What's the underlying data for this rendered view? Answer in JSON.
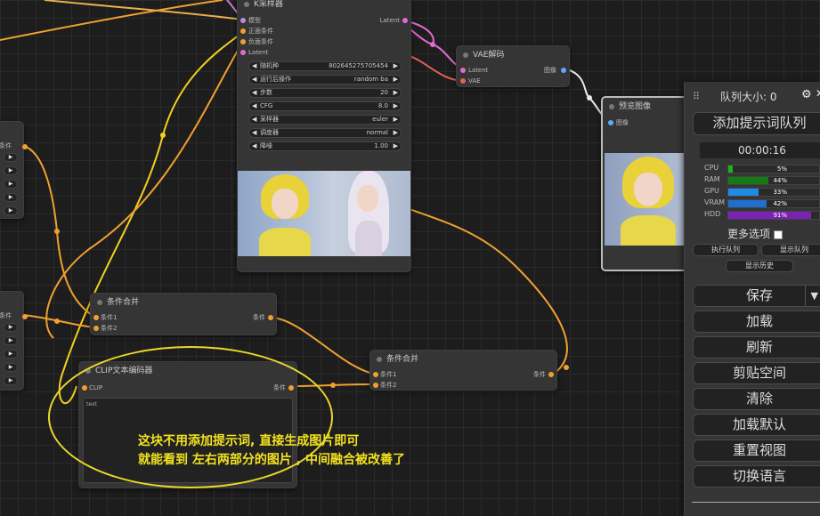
{
  "ksampler": {
    "title": "K采样器",
    "inputs": [
      "模型",
      "正面条件",
      "负面条件",
      "Latent"
    ],
    "output": "Latent",
    "widgets": [
      {
        "label": "随机种",
        "value": "802645275705454"
      },
      {
        "label": "运行后操作",
        "value": "random ba"
      },
      {
        "label": "步数",
        "value": "20"
      },
      {
        "label": "CFG",
        "value": "8.0"
      },
      {
        "label": "采样器",
        "value": "euler"
      },
      {
        "label": "调度器",
        "value": "normal"
      },
      {
        "label": "降噪",
        "value": "1.00"
      }
    ]
  },
  "vae_decode": {
    "title": "VAE解码",
    "inputs": [
      "Latent",
      "VAE"
    ],
    "output": "图像"
  },
  "preview": {
    "title": "预览图像",
    "input": "图像"
  },
  "cond_combine_1": {
    "title": "条件合并",
    "inputs": [
      "条件1",
      "条件2"
    ],
    "output": "条件"
  },
  "cond_combine_2": {
    "title": "条件合并",
    "inputs": [
      "条件1",
      "条件2"
    ],
    "output": "条件"
  },
  "clip_encode": {
    "title": "CLIP文本编码器",
    "input": "CLIP",
    "output": "条件",
    "text_value": "text"
  },
  "left_nodes": {
    "slot_label": "条件"
  },
  "annotation": {
    "line1": "这块不用添加提示词, 直接生成图片即可",
    "line2": "就能看到 左右两部分的图片 , 中间融合被改善了"
  },
  "panel": {
    "queue_size_label": "队列大小: 0",
    "queue_prompt": "添加提示词队列",
    "timer": "00:00:16",
    "meters": [
      {
        "name": "CPU",
        "percent": 5,
        "label": "5%",
        "color": "#1bb31b"
      },
      {
        "name": "RAM",
        "percent": 44,
        "label": "44%",
        "color": "#157a15"
      },
      {
        "name": "GPU",
        "percent": 33,
        "label": "33%",
        "color": "#1f8be8"
      },
      {
        "name": "VRAM",
        "percent": 42,
        "label": "42%",
        "color": "#1f6ed0"
      },
      {
        "name": "HDD",
        "percent": 91,
        "label": "91%",
        "color": "#7b22b3"
      }
    ],
    "extra_options": "更多选项",
    "run_queue": "执行队列",
    "view_queue": "显示队列",
    "view_history": "显示历史",
    "save": "保存",
    "load": "加载",
    "refresh": "刷新",
    "clipspace": "剪贴空间",
    "clear": "清除",
    "load_default": "加载默认",
    "reset_view": "重置视图",
    "switch_locale": "切换语言"
  }
}
